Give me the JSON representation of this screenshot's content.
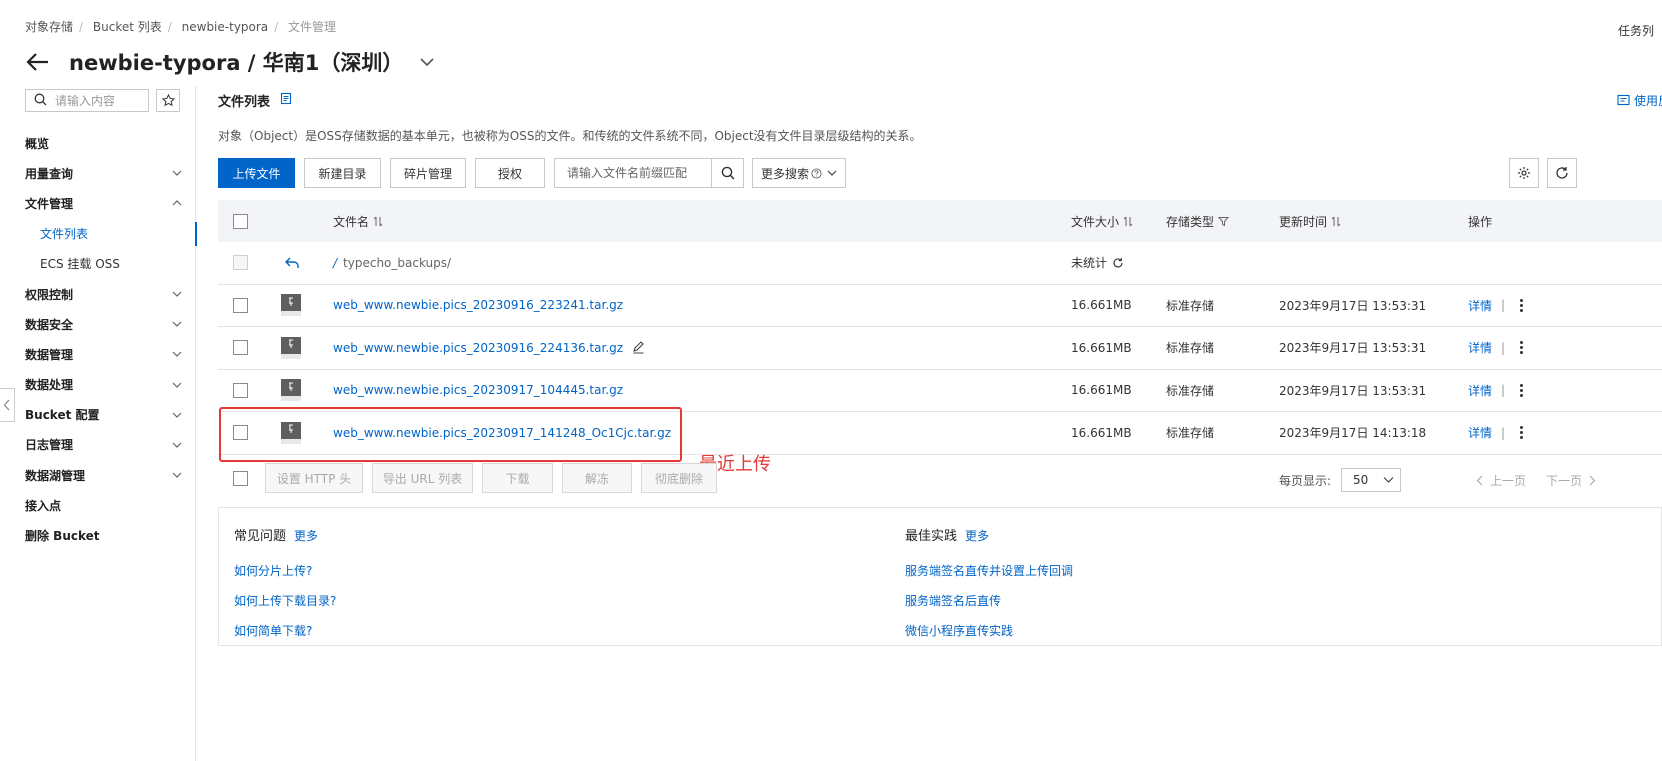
{
  "breadcrumb": {
    "items": [
      "对象存储",
      "Bucket 列表",
      "newbie-typora",
      "文件管理"
    ],
    "task_list": "任务列"
  },
  "header": {
    "title": "newbie-typora / 华南1（深圳）"
  },
  "sidebar": {
    "search_placeholder": "请输入内容",
    "items": [
      {
        "label": "概览"
      },
      {
        "label": "用量查询"
      },
      {
        "label": "文件管理"
      },
      {
        "label": "文件列表"
      },
      {
        "label": "ECS 挂载 OSS"
      },
      {
        "label": "权限控制"
      },
      {
        "label": "数据安全"
      },
      {
        "label": "数据管理"
      },
      {
        "label": "数据处理"
      },
      {
        "label": "Bucket 配置"
      },
      {
        "label": "日志管理"
      },
      {
        "label": "数据湖管理"
      },
      {
        "label": "接入点"
      },
      {
        "label": "删除 Bucket"
      }
    ]
  },
  "main": {
    "section_title": "文件列表",
    "feedback": "使用反",
    "description": "对象（Object）是OSS存储数据的基本单元，也被称为OSS的文件。和传统的文件系统不同，Object没有文件目录层级结构的关系。",
    "toolbar": {
      "upload": "上传文件",
      "new_dir": "新建目录",
      "fragment": "碎片管理",
      "authorize": "授权",
      "search_placeholder": "请输入文件名前缀匹配",
      "more_search": "更多搜索"
    },
    "table": {
      "headers": {
        "name": "文件名",
        "size": "文件大小",
        "storage": "存储类型",
        "updated": "更新时间",
        "actions": "操作"
      },
      "parent_row": {
        "name": "typecho_backups/",
        "size": "未统计"
      },
      "rows": [
        {
          "name": "web_www.newbie.pics_20230916_223241.tar.gz",
          "size": "16.661MB",
          "storage": "标准存储",
          "updated": "2023年9月17日 13:53:31",
          "action": "详情"
        },
        {
          "name": "web_www.newbie.pics_20230916_224136.tar.gz",
          "size": "16.661MB",
          "storage": "标准存储",
          "updated": "2023年9月17日 13:53:31",
          "action": "详情"
        },
        {
          "name": "web_www.newbie.pics_20230917_104445.tar.gz",
          "size": "16.661MB",
          "storage": "标准存储",
          "updated": "2023年9月17日 13:53:31",
          "action": "详情"
        },
        {
          "name": "web_www.newbie.pics_20230917_141248_Oc1Cjc.tar.gz",
          "size": "16.661MB",
          "storage": "标准存储",
          "updated": "2023年9月17日 14:13:18",
          "action": "详情"
        }
      ],
      "op_separator": "|"
    },
    "annotation": "最近上传",
    "footer_actions": {
      "set_http": "设置 HTTP 头",
      "export_url": "导出 URL 列表",
      "download": "下载",
      "unfreeze": "解冻",
      "delete": "彻底删除"
    },
    "pager": {
      "per_page_label": "每页显示:",
      "per_page_value": "50",
      "prev": "上一页",
      "next": "下一页"
    },
    "help": {
      "faq_title": "常见问题",
      "faq_more": "更多",
      "faq_links": [
        "如何分片上传?",
        "如何上传下载目录?",
        "如何简单下载?"
      ],
      "best_title": "最佳实践",
      "best_more": "更多",
      "best_links": [
        "服务端签名直传并设置上传回调",
        "服务端签名后直传",
        "微信小程序直传实践"
      ]
    }
  },
  "colors": {
    "primary": "#0064c8",
    "annotation": "#e53935"
  }
}
